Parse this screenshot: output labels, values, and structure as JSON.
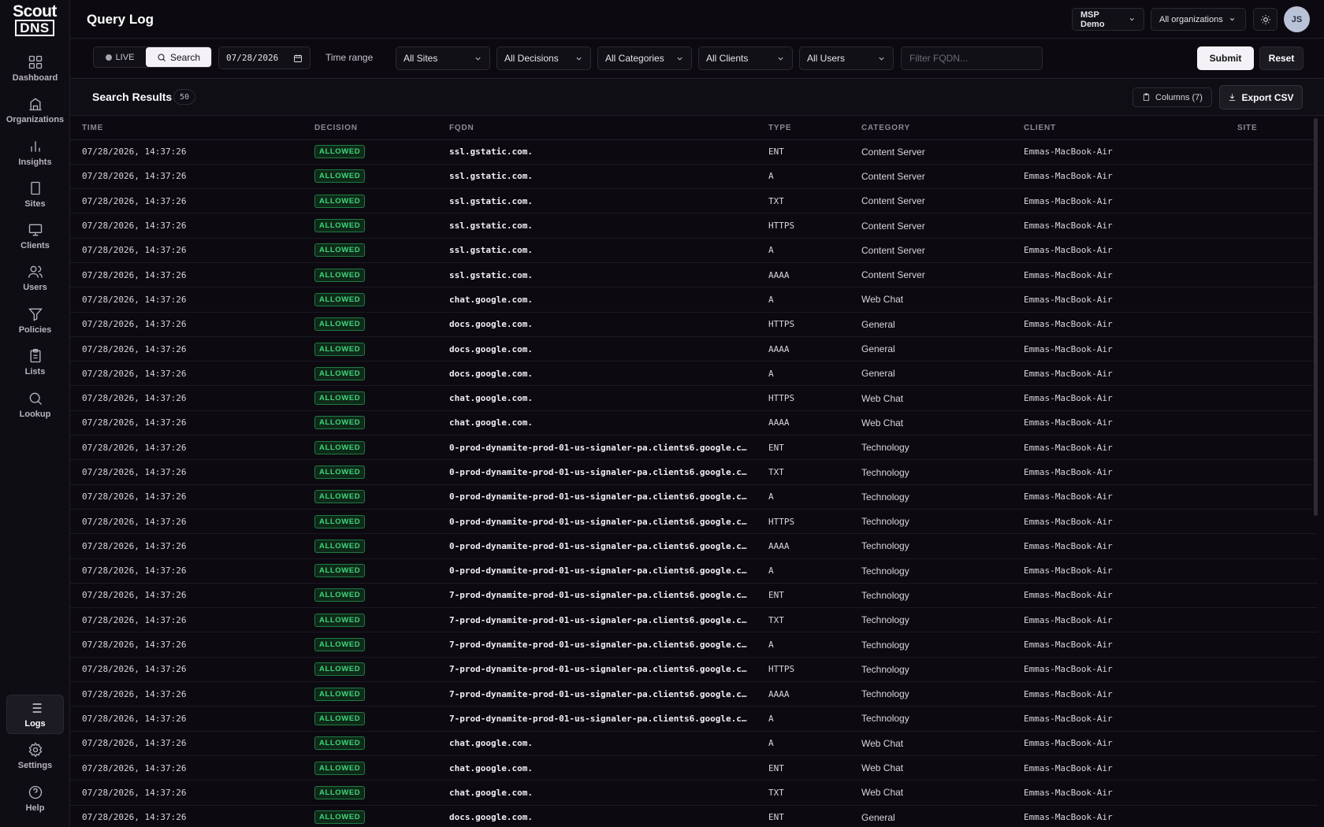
{
  "app": {
    "logo_top": "Scout",
    "logo_bottom": "DNS",
    "page_title": "Query Log"
  },
  "sidebar": {
    "items": [
      {
        "label": "Dashboard",
        "icon": "grid-icon"
      },
      {
        "label": "Organizations",
        "icon": "building-icon"
      },
      {
        "label": "Insights",
        "icon": "bar-chart-icon"
      },
      {
        "label": "Sites",
        "icon": "office-icon"
      },
      {
        "label": "Clients",
        "icon": "monitor-icon"
      },
      {
        "label": "Users",
        "icon": "users-icon"
      },
      {
        "label": "Policies",
        "icon": "filter-icon"
      },
      {
        "label": "Lists",
        "icon": "clipboard-icon"
      },
      {
        "label": "Lookup",
        "icon": "search-icon"
      }
    ],
    "bottom": [
      {
        "label": "Logs",
        "icon": "list-icon",
        "active": true
      },
      {
        "label": "Settings",
        "icon": "gear-icon"
      },
      {
        "label": "Help",
        "icon": "help-icon"
      }
    ]
  },
  "header": {
    "org_switch": "MSP Demo",
    "org_filter": "All organizations",
    "avatar_initials": "JS"
  },
  "filters": {
    "live_label": "LIVE",
    "search_label": "Search",
    "date_value": "07/28/2026",
    "time_range_label": "Time range",
    "sites": "All Sites",
    "decisions": "All Decisions",
    "categories": "All Categories",
    "clients": "All Clients",
    "users": "All Users",
    "fqdn_placeholder": "Filter FQDN...",
    "submit_label": "Submit",
    "reset_label": "Reset"
  },
  "results": {
    "title": "Search Results",
    "count": "50",
    "columns_label": "Columns (7)",
    "export_label": "Export CSV"
  },
  "table": {
    "headers": [
      "TIME",
      "DECISION",
      "FQDN",
      "TYPE",
      "CATEGORY",
      "CLIENT",
      "SITE"
    ],
    "rows": [
      [
        "07/28/2026, 14:37:26",
        "ALLOWED",
        "ssl.gstatic.com.",
        "ENT",
        "Content Server",
        "Emmas-MacBook-Air",
        ""
      ],
      [
        "07/28/2026, 14:37:26",
        "ALLOWED",
        "ssl.gstatic.com.",
        "A",
        "Content Server",
        "Emmas-MacBook-Air",
        ""
      ],
      [
        "07/28/2026, 14:37:26",
        "ALLOWED",
        "ssl.gstatic.com.",
        "TXT",
        "Content Server",
        "Emmas-MacBook-Air",
        ""
      ],
      [
        "07/28/2026, 14:37:26",
        "ALLOWED",
        "ssl.gstatic.com.",
        "HTTPS",
        "Content Server",
        "Emmas-MacBook-Air",
        ""
      ],
      [
        "07/28/2026, 14:37:26",
        "ALLOWED",
        "ssl.gstatic.com.",
        "A",
        "Content Server",
        "Emmas-MacBook-Air",
        ""
      ],
      [
        "07/28/2026, 14:37:26",
        "ALLOWED",
        "ssl.gstatic.com.",
        "AAAA",
        "Content Server",
        "Emmas-MacBook-Air",
        ""
      ],
      [
        "07/28/2026, 14:37:26",
        "ALLOWED",
        "chat.google.com.",
        "A",
        "Web Chat",
        "Emmas-MacBook-Air",
        ""
      ],
      [
        "07/28/2026, 14:37:26",
        "ALLOWED",
        "docs.google.com.",
        "HTTPS",
        "General",
        "Emmas-MacBook-Air",
        ""
      ],
      [
        "07/28/2026, 14:37:26",
        "ALLOWED",
        "docs.google.com.",
        "AAAA",
        "General",
        "Emmas-MacBook-Air",
        ""
      ],
      [
        "07/28/2026, 14:37:26",
        "ALLOWED",
        "docs.google.com.",
        "A",
        "General",
        "Emmas-MacBook-Air",
        ""
      ],
      [
        "07/28/2026, 14:37:26",
        "ALLOWED",
        "chat.google.com.",
        "HTTPS",
        "Web Chat",
        "Emmas-MacBook-Air",
        ""
      ],
      [
        "07/28/2026, 14:37:26",
        "ALLOWED",
        "chat.google.com.",
        "AAAA",
        "Web Chat",
        "Emmas-MacBook-Air",
        ""
      ],
      [
        "07/28/2026, 14:37:26",
        "ALLOWED",
        "0-prod-dynamite-prod-01-us-signaler-pa.clients6.google.c…",
        "ENT",
        "Technology",
        "Emmas-MacBook-Air",
        ""
      ],
      [
        "07/28/2026, 14:37:26",
        "ALLOWED",
        "0-prod-dynamite-prod-01-us-signaler-pa.clients6.google.c…",
        "TXT",
        "Technology",
        "Emmas-MacBook-Air",
        ""
      ],
      [
        "07/28/2026, 14:37:26",
        "ALLOWED",
        "0-prod-dynamite-prod-01-us-signaler-pa.clients6.google.c…",
        "A",
        "Technology",
        "Emmas-MacBook-Air",
        ""
      ],
      [
        "07/28/2026, 14:37:26",
        "ALLOWED",
        "0-prod-dynamite-prod-01-us-signaler-pa.clients6.google.c…",
        "HTTPS",
        "Technology",
        "Emmas-MacBook-Air",
        ""
      ],
      [
        "07/28/2026, 14:37:26",
        "ALLOWED",
        "0-prod-dynamite-prod-01-us-signaler-pa.clients6.google.c…",
        "AAAA",
        "Technology",
        "Emmas-MacBook-Air",
        ""
      ],
      [
        "07/28/2026, 14:37:26",
        "ALLOWED",
        "0-prod-dynamite-prod-01-us-signaler-pa.clients6.google.c…",
        "A",
        "Technology",
        "Emmas-MacBook-Air",
        ""
      ],
      [
        "07/28/2026, 14:37:26",
        "ALLOWED",
        "7-prod-dynamite-prod-01-us-signaler-pa.clients6.google.c…",
        "ENT",
        "Technology",
        "Emmas-MacBook-Air",
        ""
      ],
      [
        "07/28/2026, 14:37:26",
        "ALLOWED",
        "7-prod-dynamite-prod-01-us-signaler-pa.clients6.google.c…",
        "TXT",
        "Technology",
        "Emmas-MacBook-Air",
        ""
      ],
      [
        "07/28/2026, 14:37:26",
        "ALLOWED",
        "7-prod-dynamite-prod-01-us-signaler-pa.clients6.google.c…",
        "A",
        "Technology",
        "Emmas-MacBook-Air",
        ""
      ],
      [
        "07/28/2026, 14:37:26",
        "ALLOWED",
        "7-prod-dynamite-prod-01-us-signaler-pa.clients6.google.c…",
        "HTTPS",
        "Technology",
        "Emmas-MacBook-Air",
        ""
      ],
      [
        "07/28/2026, 14:37:26",
        "ALLOWED",
        "7-prod-dynamite-prod-01-us-signaler-pa.clients6.google.c…",
        "AAAA",
        "Technology",
        "Emmas-MacBook-Air",
        ""
      ],
      [
        "07/28/2026, 14:37:26",
        "ALLOWED",
        "7-prod-dynamite-prod-01-us-signaler-pa.clients6.google.c…",
        "A",
        "Technology",
        "Emmas-MacBook-Air",
        ""
      ],
      [
        "07/28/2026, 14:37:26",
        "ALLOWED",
        "chat.google.com.",
        "A",
        "Web Chat",
        "Emmas-MacBook-Air",
        ""
      ],
      [
        "07/28/2026, 14:37:26",
        "ALLOWED",
        "chat.google.com.",
        "ENT",
        "Web Chat",
        "Emmas-MacBook-Air",
        ""
      ],
      [
        "07/28/2026, 14:37:26",
        "ALLOWED",
        "chat.google.com.",
        "TXT",
        "Web Chat",
        "Emmas-MacBook-Air",
        ""
      ],
      [
        "07/28/2026, 14:37:26",
        "ALLOWED",
        "docs.google.com.",
        "ENT",
        "General",
        "Emmas-MacBook-Air",
        ""
      ]
    ]
  },
  "colors": {
    "allowed_text": "#3fd67c",
    "allowed_bg": "#0e2a18",
    "background": "#0c0a10"
  }
}
